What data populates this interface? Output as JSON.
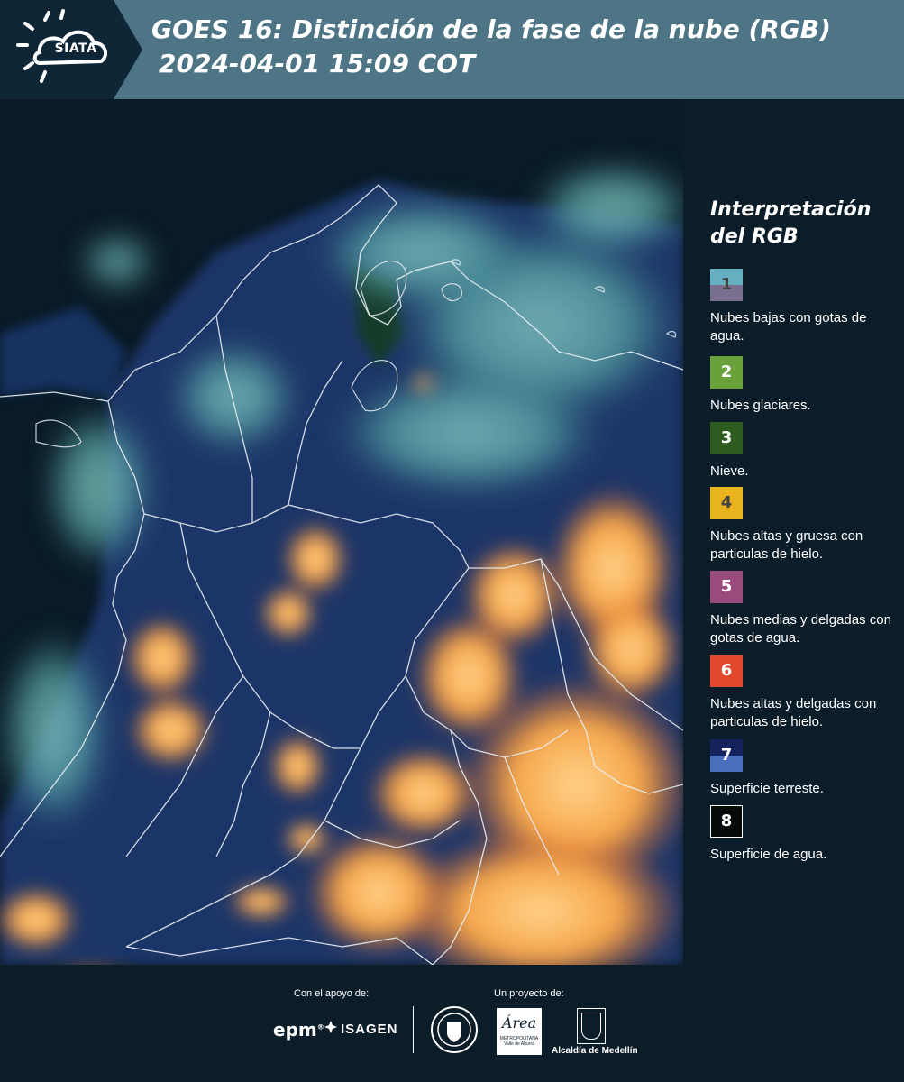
{
  "header": {
    "logo_text": "SIATA",
    "title_line1": "GOES 16: Distinción de la fase de la nube (RGB)",
    "title_line2": "2024-04-01 15:09 COT"
  },
  "legend": {
    "title_line1": "Interpretación",
    "title_line2": "del RGB",
    "items": [
      {
        "number": "1",
        "label": "Nubes bajas con gotas de agua.",
        "color_top": "#64afc0",
        "color_bottom": "#7a6e8e",
        "num_color": "#444444"
      },
      {
        "number": "2",
        "label": "Nubes glaciares.",
        "color_top": "#69a23a",
        "color_bottom": "#69a23a",
        "num_color": "#ffffff"
      },
      {
        "number": "3",
        "label": "Nieve.",
        "color_top": "#2e5c1e",
        "color_bottom": "#2e5c1e",
        "num_color": "#ffffff"
      },
      {
        "number": "4",
        "label": "Nubes altas y gruesa con particulas de hielo.",
        "color_top": "#e8b31c",
        "color_bottom": "#e8b31c",
        "num_color": "#444444"
      },
      {
        "number": "5",
        "label": "Nubes medias y delgadas con gotas de agua.",
        "color_top": "#9b4a7e",
        "color_bottom": "#9b4a7e",
        "num_color": "#ffffff"
      },
      {
        "number": "6",
        "label": "Nubes altas y delgadas con particulas de hielo.",
        "color_top": "#e2482c",
        "color_bottom": "#e2482c",
        "num_color": "#ffffff"
      },
      {
        "number": "7",
        "label": "Superficie terreste.",
        "color_top": "#14225e",
        "color_bottom": "#4a6fbe",
        "num_color": "#ffffff"
      },
      {
        "number": "8",
        "label": "Superficie de agua.",
        "color_top": "#050b07",
        "color_bottom": "#050b07",
        "num_color": "#ffffff"
      }
    ]
  },
  "footer": {
    "support_label": "Con el apoyo de:",
    "project_label": "Un proyecto de:",
    "epm_text": "epm",
    "epm_mark": "®",
    "isagen_text": "ISAGEN",
    "area_text": "Área",
    "area_sub": "METROPOLITANA Valle de Aburrá",
    "medellin_text": "Alcaldía de Medellín"
  },
  "colors": {
    "header_bg": "#4d7585",
    "page_bg": "#0c1d2a",
    "cloud_orange": "#f6a64a",
    "cloud_cyan": "#79c6c2",
    "land_blue": "#1c3568",
    "ocean": "#0a1a27"
  }
}
